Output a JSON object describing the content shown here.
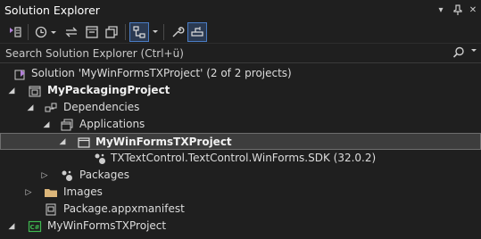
{
  "window": {
    "title": "Solution Explorer",
    "controls": {
      "dropdown": "▾",
      "pin": "📌",
      "close": "✕"
    }
  },
  "toolbar": {
    "buttons": [
      {
        "name": "switch-views-icon"
      },
      {
        "name": "pending-changes-filter-icon"
      },
      {
        "name": "sync-with-active-document-icon"
      },
      {
        "name": "collapse-all-icon"
      },
      {
        "name": "show-all-files-icon"
      },
      {
        "name": "show-hierarchy-icon",
        "active": true
      },
      {
        "name": "properties-icon"
      },
      {
        "name": "preview-selected-items-icon",
        "active": true
      }
    ]
  },
  "search": {
    "placeholder": "Search Solution Explorer (Ctrl+ü)"
  },
  "tree": {
    "items": [
      {
        "label": "Solution 'MyWinFormsTXProject' (2 of 2 projects)",
        "icon": "solution-icon",
        "expander": "",
        "bold": false
      },
      {
        "label": "MyPackagingProject",
        "icon": "packaging-project-icon",
        "expander": "◢",
        "bold": true
      },
      {
        "label": "Dependencies",
        "icon": "dependencies-icon",
        "expander": "◢",
        "bold": false
      },
      {
        "label": "Applications",
        "icon": "applications-icon",
        "expander": "◢",
        "bold": false
      },
      {
        "label": "MyWinFormsTXProject",
        "icon": "window-app-icon",
        "expander": "◢",
        "bold": true,
        "selected": true
      },
      {
        "label": "TXTextControl.TextControl.WinForms.SDK (32.0.2)",
        "icon": "nuget-package-icon",
        "expander": "",
        "bold": false
      },
      {
        "label": "Packages",
        "icon": "packages-icon",
        "expander": "▷",
        "bold": false
      },
      {
        "label": "Images",
        "icon": "folder-icon",
        "expander": "▷",
        "bold": false
      },
      {
        "label": "Package.appxmanifest",
        "icon": "manifest-icon",
        "expander": "",
        "bold": false
      },
      {
        "label": "MyWinFormsTXProject",
        "icon": "csharp-project-icon",
        "expander": "◢",
        "bold": false
      }
    ]
  },
  "colors": {
    "background": "#1f1f1f",
    "selection": "#3d3d3d",
    "accent": "#4a7cc4",
    "csharp": "#3fb950",
    "vs_purple": "#b180d7"
  }
}
